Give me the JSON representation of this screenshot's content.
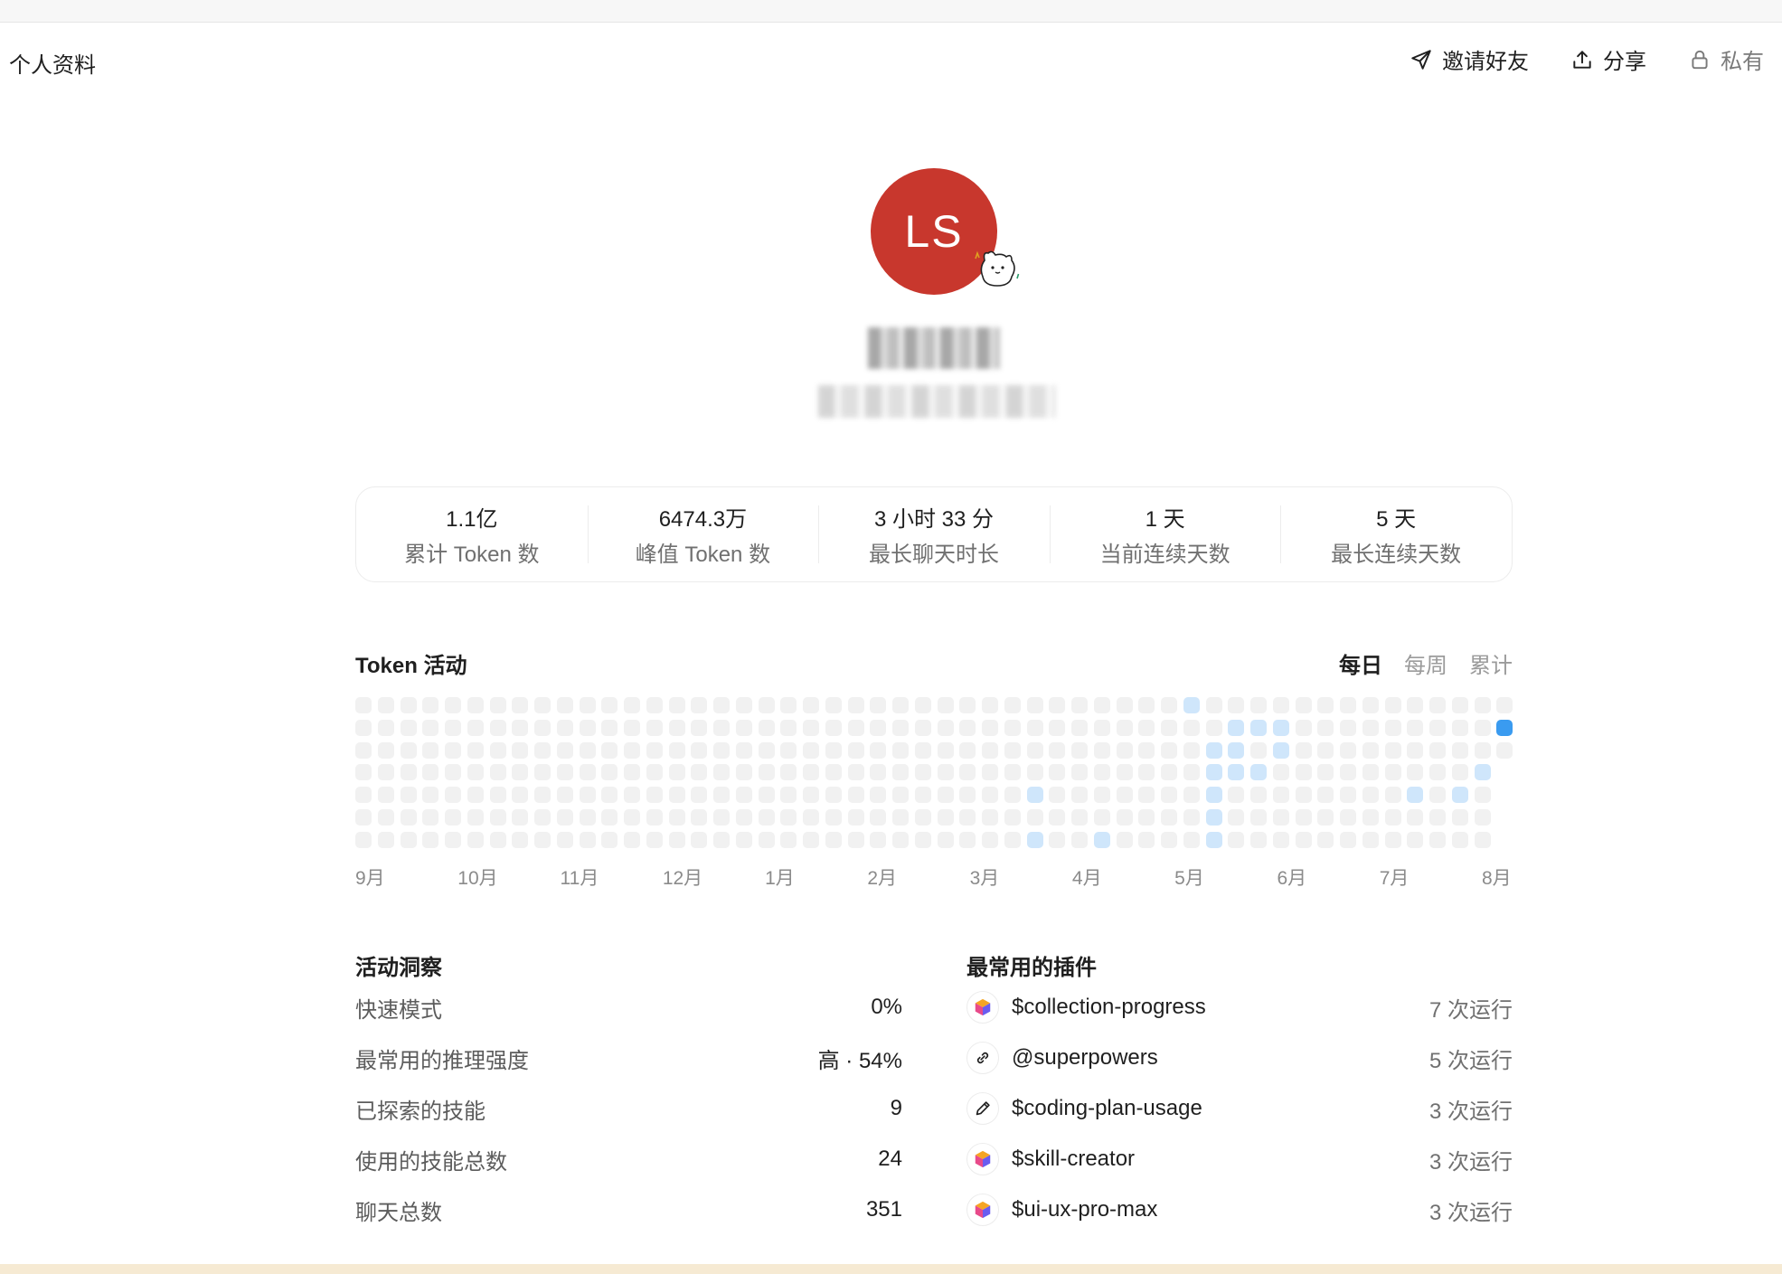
{
  "header": {
    "title": "个人资料",
    "invite_label": "邀请好友",
    "share_label": "分享",
    "private_label": "私有"
  },
  "profile": {
    "avatar_initials": "LS",
    "avatar_color": "#c8372d"
  },
  "stats": [
    {
      "value": "1.1亿",
      "label": "累计 Token 数"
    },
    {
      "value": "6474.3万",
      "label": "峰值 Token 数"
    },
    {
      "value": "3 小时 33 分",
      "label": "最长聊天时长"
    },
    {
      "value": "1 天",
      "label": "当前连续天数"
    },
    {
      "value": "5 天",
      "label": "最长连续天数"
    }
  ],
  "token_activity": {
    "title": "Token 活动",
    "tabs": [
      "每日",
      "每周",
      "累计"
    ],
    "active_tab": "每日",
    "months": [
      "9月",
      "10月",
      "11月",
      "12月",
      "1月",
      "2月",
      "3月",
      "4月",
      "5月",
      "6月",
      "7月",
      "8月"
    ],
    "active_cells": [
      {
        "week": 37,
        "day": 0,
        "level": 1
      },
      {
        "week": 39,
        "day": 1,
        "level": 1
      },
      {
        "week": 40,
        "day": 1,
        "level": 1
      },
      {
        "week": 41,
        "day": 1,
        "level": 1
      },
      {
        "week": 38,
        "day": 2,
        "level": 1
      },
      {
        "week": 39,
        "day": 2,
        "level": 1
      },
      {
        "week": 41,
        "day": 2,
        "level": 1
      },
      {
        "week": 38,
        "day": 3,
        "level": 1
      },
      {
        "week": 39,
        "day": 3,
        "level": 1
      },
      {
        "week": 40,
        "day": 3,
        "level": 1
      },
      {
        "week": 50,
        "day": 3,
        "level": 1
      },
      {
        "week": 30,
        "day": 4,
        "level": 1
      },
      {
        "week": 38,
        "day": 4,
        "level": 1
      },
      {
        "week": 47,
        "day": 4,
        "level": 1
      },
      {
        "week": 49,
        "day": 4,
        "level": 1
      },
      {
        "week": 38,
        "day": 5,
        "level": 1
      },
      {
        "week": 30,
        "day": 6,
        "level": 1
      },
      {
        "week": 33,
        "day": 6,
        "level": 1
      },
      {
        "week": 38,
        "day": 6,
        "level": 1
      },
      {
        "week": 51,
        "day": 1,
        "level": 3
      }
    ]
  },
  "insights": {
    "title": "活动洞察",
    "rows": [
      {
        "label": "快速模式",
        "value": "0%"
      },
      {
        "label": "最常用的推理强度",
        "value": "高 · 54%"
      },
      {
        "label": "已探索的技能",
        "value": "9"
      },
      {
        "label": "使用的技能总数",
        "value": "24"
      },
      {
        "label": "聊天总数",
        "value": "351"
      }
    ]
  },
  "plugins": {
    "title": "最常用的插件",
    "rows": [
      {
        "icon": "cube-icon",
        "name": "$collection-progress",
        "count": "7 次运行"
      },
      {
        "icon": "link-icon",
        "name": "@superpowers",
        "count": "5 次运行"
      },
      {
        "icon": "pencil-icon",
        "name": "$coding-plan-usage",
        "count": "3 次运行"
      },
      {
        "icon": "cube-icon",
        "name": "$skill-creator",
        "count": "3 次运行"
      },
      {
        "icon": "cube-icon",
        "name": "$ui-ux-pro-max",
        "count": "3 次运行"
      }
    ]
  }
}
